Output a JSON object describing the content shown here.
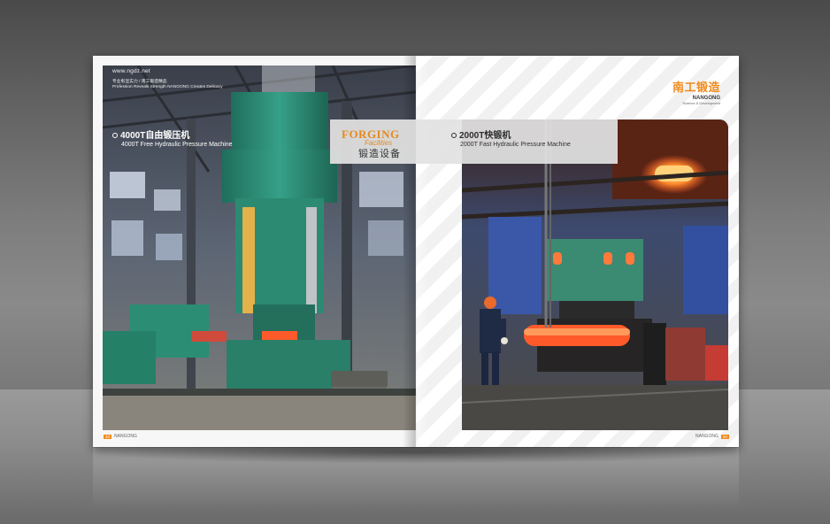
{
  "left_page": {
    "website": "www.ngdz.net",
    "tagline_cn": "专业彰显实力 / 南工锻造精品",
    "tagline_en": "Profession Reveals Strength  NANGONG Creates Delicacy",
    "machine_title": "4000T自由锻压机",
    "machine_subtitle": "4000T Free Hydraulic Pressure Machine",
    "page_number": "33",
    "footer_brand": "NANGONG"
  },
  "right_page": {
    "machine_title": "2000T快锻机",
    "machine_subtitle": "2000T Fast Hydraulic Pressure Machine",
    "page_number": "34",
    "footer_brand": "NANGONG"
  },
  "banner": {
    "forging": "FORGING",
    "facilities": "Facilities",
    "title_cn": "锻造设备"
  },
  "logo": {
    "name_cn": "南工锻造",
    "name_en": "NANGONG",
    "tagline": "Science & Development"
  },
  "colors": {
    "accent": "#f08a1c",
    "machine_green": "#2f8f78",
    "hot_metal": "#ff5a2a"
  }
}
